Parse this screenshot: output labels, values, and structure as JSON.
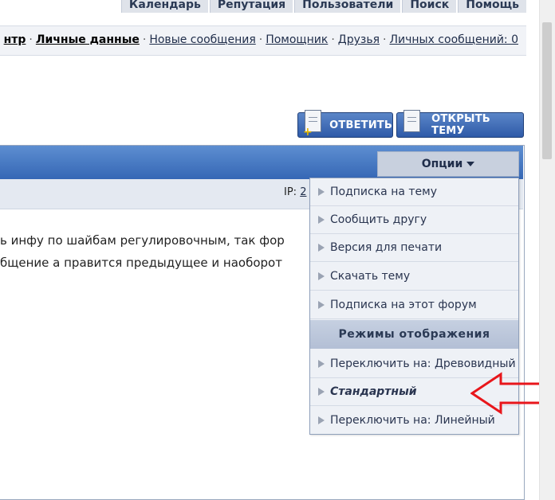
{
  "top_nav": {
    "items": [
      "Календарь",
      "Репутация",
      "Пользователи",
      "Поиск",
      "Помощь"
    ]
  },
  "sub_nav": {
    "first_partial": "нтр",
    "personal_data": "Личные данные",
    "new_messages": "Новые сообщения",
    "helper": "Помощник",
    "friends": "Друзья",
    "private_messages": "Личных сообщений: 0",
    "separator": "·"
  },
  "actions": {
    "reply_label": "ОТВЕТИТЬ",
    "new_topic_label": "ОТКРЫТЬ ТЕМУ"
  },
  "post": {
    "ip_label": "IP:",
    "ip_value": "2",
    "line1": "ь инфу по шайбам регулировочным, так фор",
    "line2": "бщение а правится предыдущее и наоборот"
  },
  "options": {
    "label": "Опции",
    "items": [
      "Подписка на тему",
      "Сообщить другу",
      "Версия для печати",
      "Скачать тему",
      "Подписка на этот форум"
    ],
    "display_modes_header": "Режимы отображения",
    "modes": [
      "Переключить на: Древовидный",
      "Стандартный",
      "Переключить на: Линейный"
    ]
  },
  "colors": {
    "header_blue": "#3567b5",
    "annotation_red": "#e8161b"
  }
}
